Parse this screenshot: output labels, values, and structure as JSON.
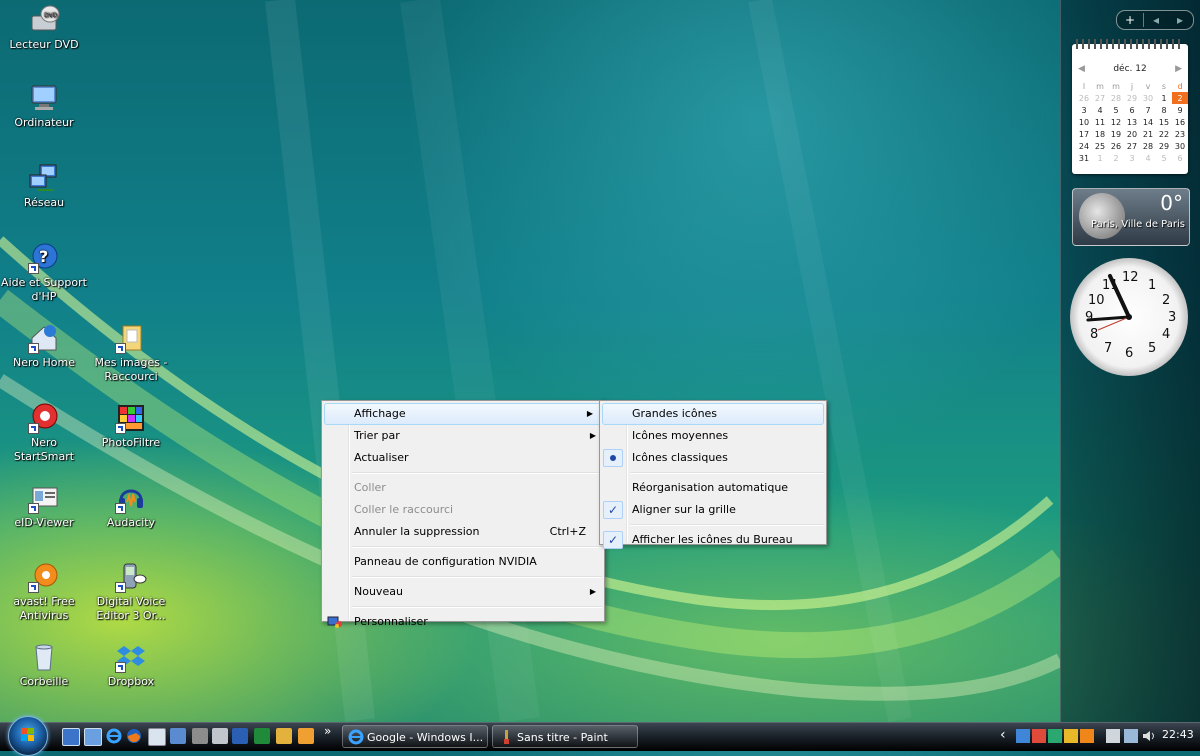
{
  "desktop": {
    "icons": [
      {
        "label": "Lecteur DVD"
      },
      {
        "label": "Ordinateur"
      },
      {
        "label": "Réseau"
      },
      {
        "label": "Aide et Support d'HP"
      },
      {
        "label": "Nero Home"
      },
      {
        "label": "Mes images - Raccourci"
      },
      {
        "label": "Nero StartSmart"
      },
      {
        "label": "PhotoFiltre"
      },
      {
        "label": "eID-Viewer"
      },
      {
        "label": "Audacity"
      },
      {
        "label": "avast! Free Antivirus"
      },
      {
        "label": "Digital Voice Editor 3 Or..."
      },
      {
        "label": "Corbeille"
      },
      {
        "label": "Dropbox"
      }
    ]
  },
  "context_menu": {
    "items": [
      {
        "label": "Affichage"
      },
      {
        "label": "Trier par"
      },
      {
        "label": "Actualiser"
      },
      {
        "label": "Coller"
      },
      {
        "label": "Coller le raccourci"
      },
      {
        "label": "Annuler la suppression",
        "shortcut": "Ctrl+Z"
      },
      {
        "label": "Panneau de configuration NVIDIA"
      },
      {
        "label": "Nouveau"
      },
      {
        "label": "Personnaliser"
      }
    ]
  },
  "submenu": {
    "items": [
      {
        "label": "Grandes icônes"
      },
      {
        "label": "Icônes moyennes"
      },
      {
        "label": "Icônes classiques"
      },
      {
        "label": "Réorganisation automatique"
      },
      {
        "label": "Aligner sur la grille"
      },
      {
        "label": "Afficher les icônes du Bureau"
      }
    ]
  },
  "sidebar": {
    "controls": {
      "add": "+",
      "prev": "◂",
      "next": "▸"
    },
    "calendar": {
      "month": "déc. 12",
      "weekdays": [
        "l",
        "m",
        "m",
        "j",
        "v",
        "s",
        "d"
      ],
      "weeks": [
        [
          "26",
          "27",
          "28",
          "29",
          "30",
          "1",
          "2"
        ],
        [
          "3",
          "4",
          "5",
          "6",
          "7",
          "8",
          "9"
        ],
        [
          "10",
          "11",
          "12",
          "13",
          "14",
          "15",
          "16"
        ],
        [
          "17",
          "18",
          "19",
          "20",
          "21",
          "22",
          "23"
        ],
        [
          "24",
          "25",
          "26",
          "27",
          "28",
          "29",
          "30"
        ],
        [
          "31",
          "1",
          "2",
          "3",
          "4",
          "5",
          "6"
        ]
      ]
    },
    "weather": {
      "temperature": "0°",
      "city": "Paris, Ville de Paris"
    },
    "clock": {
      "numbers": [
        "12",
        "1",
        "2",
        "3",
        "4",
        "5",
        "6",
        "7",
        "8",
        "9",
        "10",
        "11"
      ]
    }
  },
  "taskbar": {
    "more": "»",
    "buttons": [
      {
        "label": "Google - Windows I..."
      },
      {
        "label": "Sans titre - Paint"
      }
    ],
    "tray_chevron": "‹",
    "time": "22:43"
  },
  "colors": {
    "accent": "#2047a8",
    "today": "#f07020",
    "menu_bg": "#f0f0f0"
  }
}
